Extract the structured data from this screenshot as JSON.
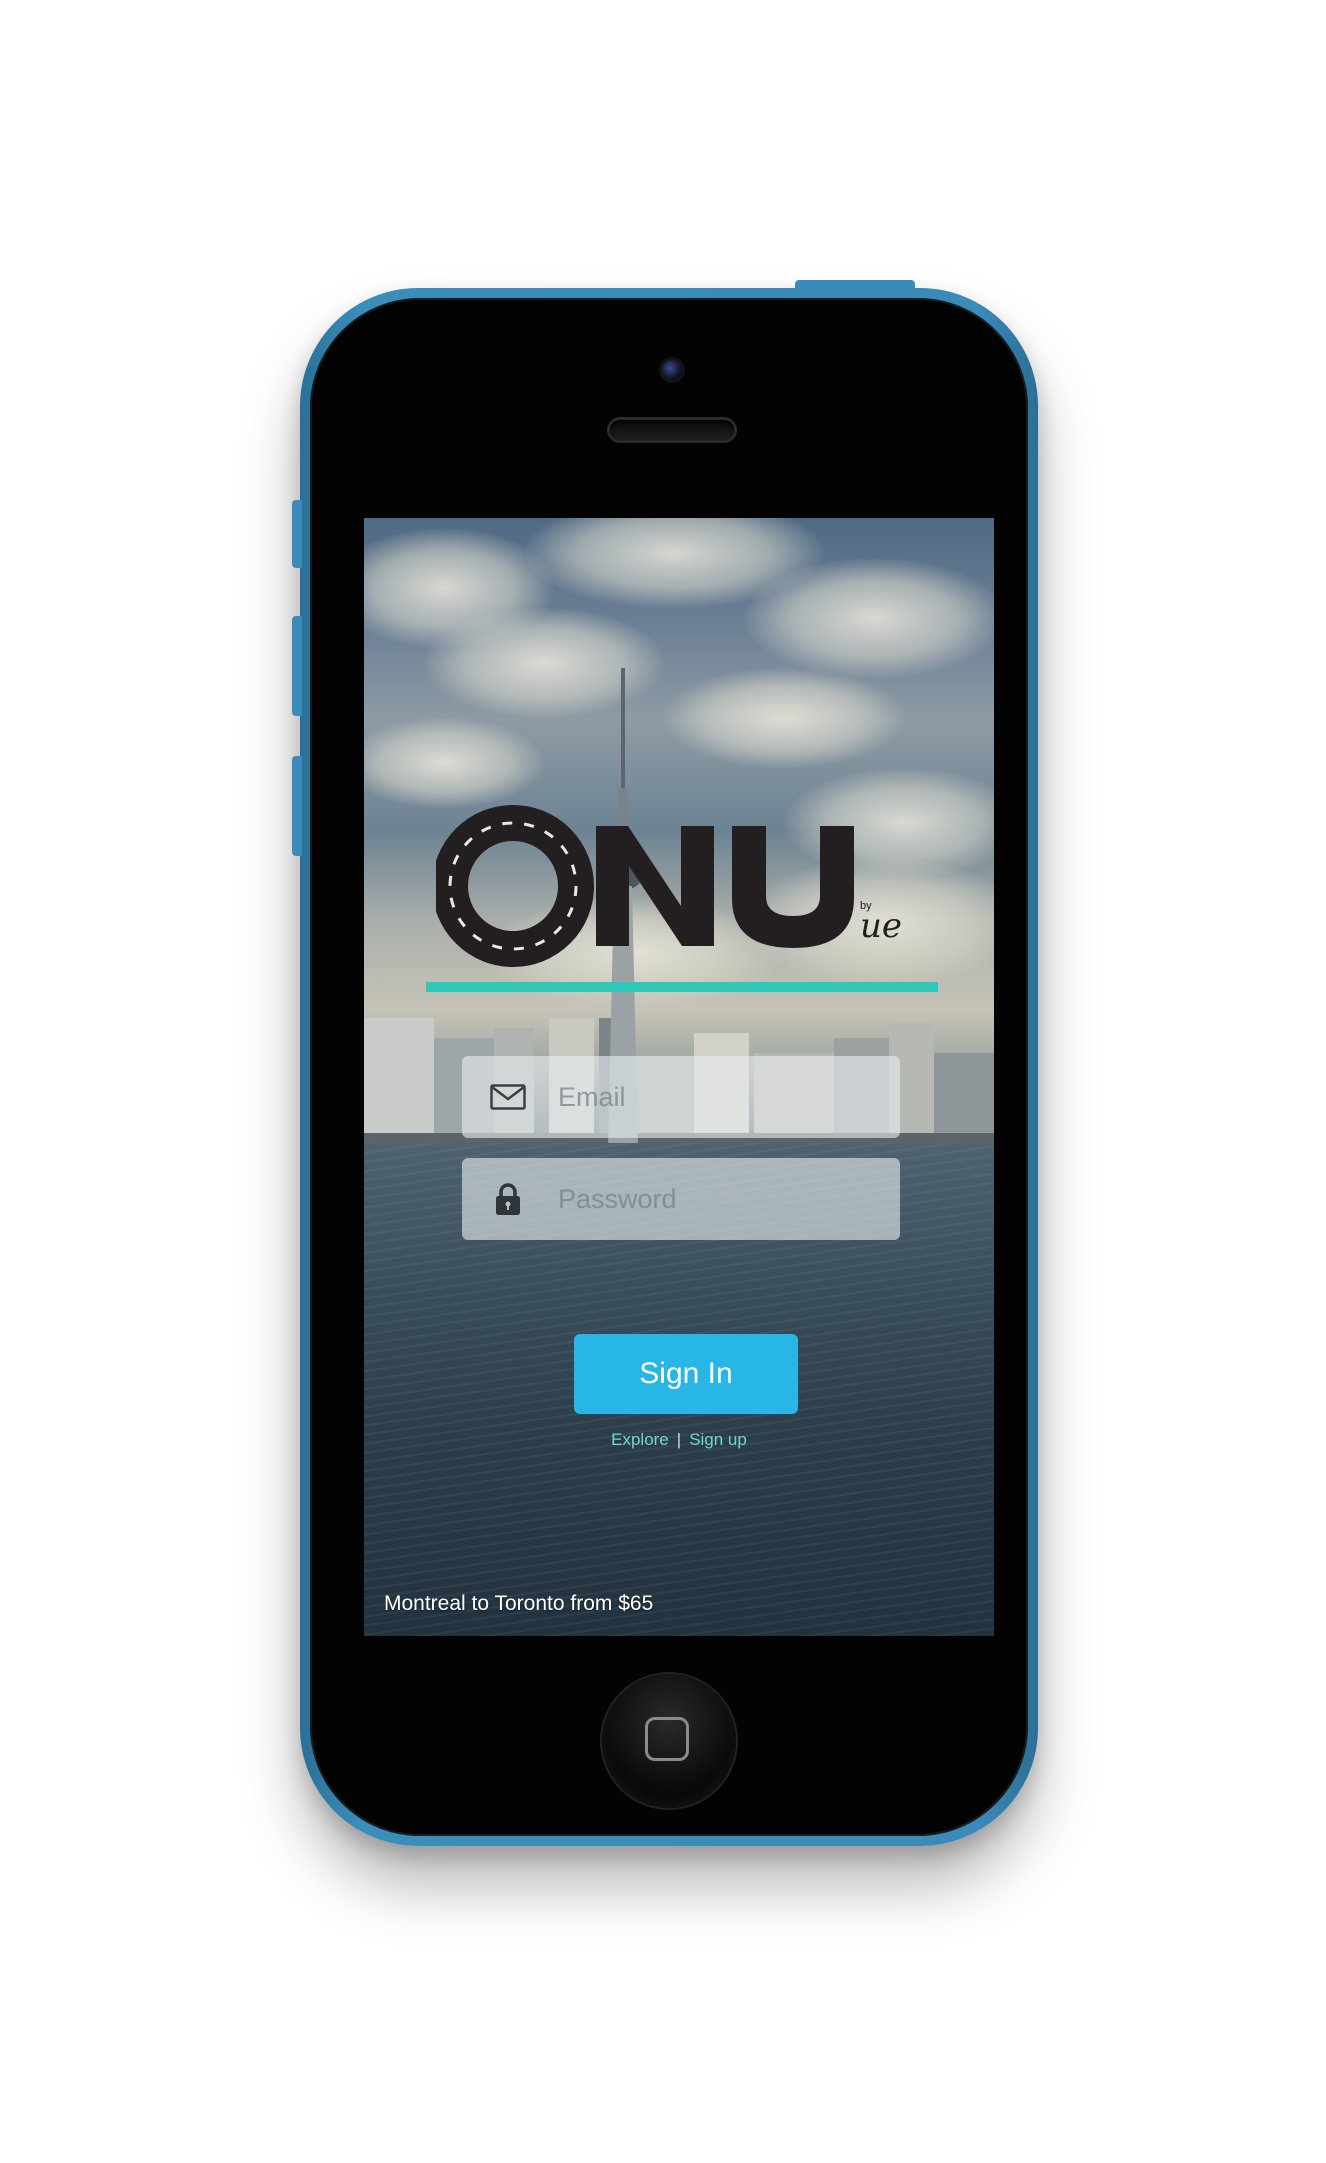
{
  "app": {
    "logo_text": "ONU",
    "logo_byline": "by",
    "logo_signature": "ue"
  },
  "login": {
    "email_placeholder": "Email",
    "password_placeholder": "Password",
    "sign_in_label": "Sign In"
  },
  "links": {
    "explore": "Explore",
    "separator": "|",
    "sign_up": "Sign up"
  },
  "promo": {
    "text": "Montreal to Toronto from $65"
  },
  "icons": {
    "email": "envelope-icon",
    "password": "lock-icon",
    "home": "home-button-icon"
  },
  "colors": {
    "phone_body": "#3a8aba",
    "accent_teal": "#2fc7b6",
    "sign_in_button": "#27b6e6",
    "link_text": "#6fd6cf"
  }
}
